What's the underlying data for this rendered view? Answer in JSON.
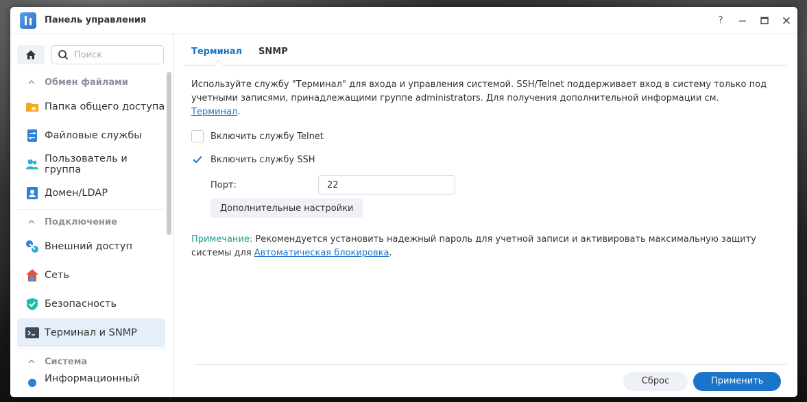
{
  "window": {
    "title": "Панель управления"
  },
  "search": {
    "placeholder": "Поиск"
  },
  "sidebar": {
    "sections": [
      {
        "label": "Обмен файлами",
        "items": [
          "Папка общего доступа",
          "Файловые службы",
          "Пользователь и группа",
          "Домен/LDAP"
        ]
      },
      {
        "label": "Подключение",
        "items": [
          "Внешний доступ",
          "Сеть",
          "Безопасность",
          "Терминал и SNMP"
        ]
      },
      {
        "label": "Система",
        "items": [
          "Информационный"
        ]
      }
    ],
    "active_item": "Терминал и SNMP"
  },
  "tabs": [
    {
      "label": "Терминал",
      "active": true
    },
    {
      "label": "SNMP",
      "active": false
    }
  ],
  "terminal": {
    "description_text": "Используйте службу \"Терминал\" для входа и управления системой. SSH/Telnet поддерживает вход в систему только под учетными записями, принадлежащими группе administrators. Для получения дополнительной информации см. ",
    "description_link": "Терминал",
    "telnet_label": "Включить службу Telnet",
    "telnet_checked": false,
    "ssh_label": "Включить службу SSH",
    "ssh_checked": true,
    "port_label": "Порт:",
    "port_value": "22",
    "advanced_label": "Дополнительные настройки",
    "note_label": "Примечание:",
    "note_text": " Рекомендуется установить надежный пароль для учетной записи и активировать максимальную защиту системы для ",
    "note_link": "Автоматическая блокировка"
  },
  "footer": {
    "reset_label": "Сброс",
    "apply_label": "Применить"
  },
  "colors": {
    "accent": "#1a74c9",
    "note": "#1a9a8e",
    "active_bg": "#e5eef9"
  }
}
